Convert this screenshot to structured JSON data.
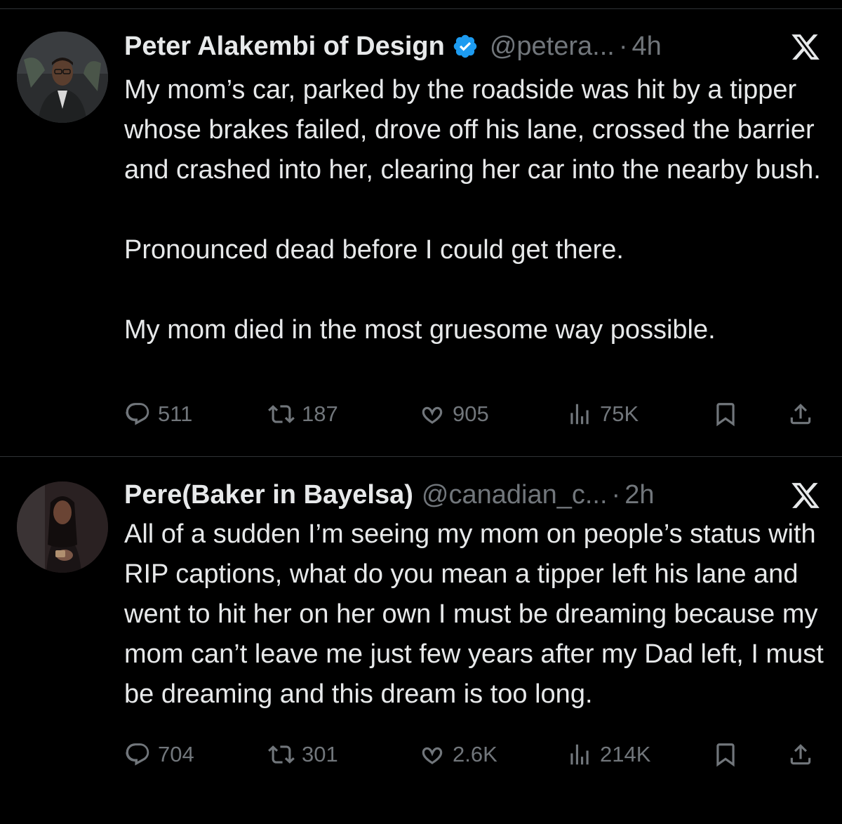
{
  "tweets": [
    {
      "display_name": "Peter Alakembi of Design",
      "verified": true,
      "handle": "@petera...",
      "dot": "·",
      "time": "4h",
      "paragraphs": [
        "My mom’s car, parked by the roadside was hit by a tipper whose brakes failed, drove off his lane, crossed the barrier and crashed into her, clearing her car into the nearby bush.",
        "Pronounced dead before I could get there.",
        "My mom died in the most gruesome way possible."
      ],
      "stats": {
        "replies": "511",
        "retweets": "187",
        "likes": "905",
        "views": "75K"
      }
    },
    {
      "display_name": "Pere(Baker in Bayelsa)",
      "verified": false,
      "handle": "@canadian_c...",
      "dot": "·",
      "time": "2h",
      "paragraphs": [
        "All of a sudden I’m seeing my mom on people’s status with RIP captions, what do you mean a tipper left his lane and went to hit her on her own I must be dreaming because my mom can’t leave me just few years after my Dad left, I must be dreaming and this dream is too long."
      ],
      "stats": {
        "replies": "704",
        "retweets": "301",
        "likes": "2.6K",
        "views": "214K"
      }
    }
  ],
  "colors": {
    "background": "#000000",
    "text": "#e7e9ea",
    "muted": "#71767b",
    "verified": "#1d9bf0",
    "divider": "#2f3336"
  },
  "icons": [
    "x-logo-icon",
    "verified-badge-icon",
    "reply-icon",
    "retweet-icon",
    "like-icon",
    "views-icon",
    "bookmark-icon",
    "share-icon"
  ]
}
